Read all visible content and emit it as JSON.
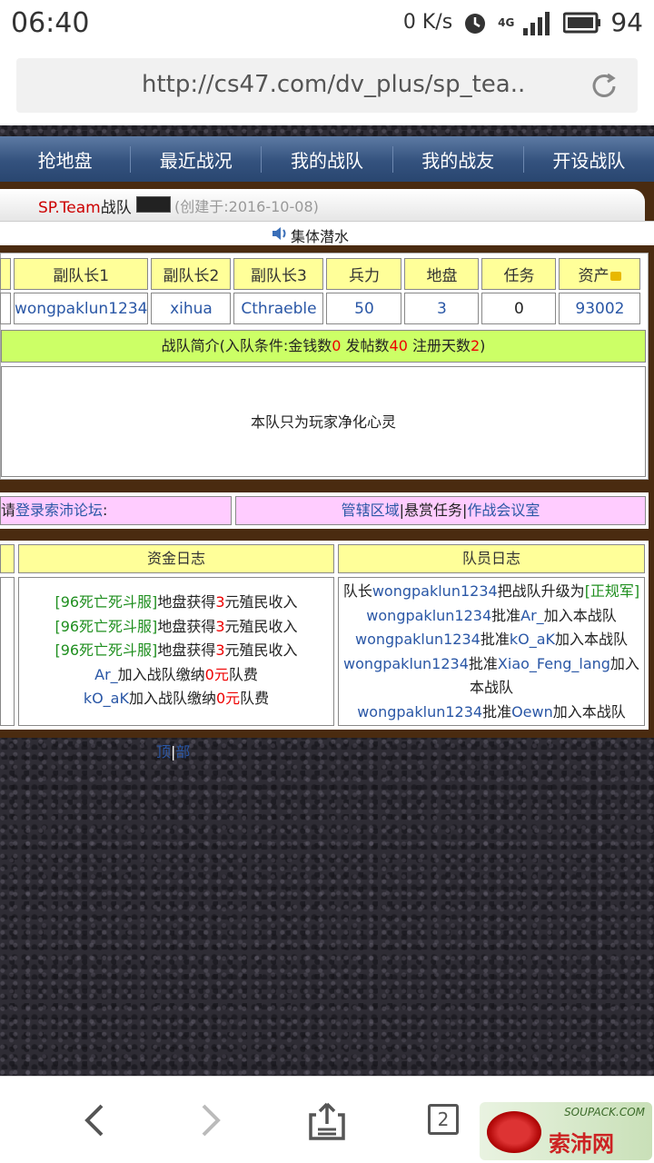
{
  "status": {
    "time": "06:40",
    "net_speed": "0 K/s",
    "network": "4G",
    "battery": "94"
  },
  "browser": {
    "url": "http://cs47.com/dv_plus/sp_tea..",
    "tab_count": "2"
  },
  "nav": [
    "抢地盘",
    "最近战况",
    "我的战队",
    "我的战友",
    "开设战队"
  ],
  "team": {
    "name": "SP.Team",
    "label": "战队",
    "created": "(创建于:2016-10-08)",
    "subtitle": "集体潜水"
  },
  "stats": {
    "headers": [
      "副队长1",
      "副队长2",
      "副队长3",
      "兵力",
      "地盘",
      "任务",
      "资产"
    ],
    "values": [
      "wongpaklun1234",
      "xihua",
      "Cthraeble",
      "50",
      "3",
      "0",
      "93002"
    ]
  },
  "intro": {
    "prefix": "战队简介(入队条件:金钱数",
    "money": "0",
    "posts_label": " 发帖数",
    "posts": "40",
    "days_label": " 注册天数",
    "days": "2",
    "suffix": ")",
    "body": "本队只为玩家净化心灵"
  },
  "links": {
    "left_prefix": "请",
    "left_link": "登录索沛论坛",
    "left_suffix": ":",
    "right": [
      "管辖区域",
      "悬赏任务",
      "作战会议室"
    ]
  },
  "fund_log": {
    "title": "资金日志",
    "entries": [
      {
        "server": "[96死亡死斗服]",
        "text": "地盘获得",
        "amount": "3",
        "unit": "元殖民收入"
      },
      {
        "server": "[96死亡死斗服]",
        "text": "地盘获得",
        "amount": "3",
        "unit": "元殖民收入"
      },
      {
        "server": "[96死亡死斗服]",
        "text": "地盘获得",
        "amount": "3",
        "unit": "元殖民收入"
      },
      {
        "server": "Ar_",
        "text": "加入战队缴纳",
        "amount": "0元",
        "unit": "队费"
      },
      {
        "server": "kO_aK",
        "text": "加入战队缴纳",
        "amount": "0元",
        "unit": "队费"
      }
    ]
  },
  "member_log": {
    "title": "队员日志",
    "line1_prefix": "队长",
    "line1_user": "wongpaklun1234",
    "line1_text": "把战队升级为",
    "line1_rank": "[正规军]",
    "approvals": [
      {
        "by": "wongpaklun1234",
        "verb": "批准",
        "who": "Ar_",
        "rest": "加入本战队"
      },
      {
        "by": "wongpaklun1234",
        "verb": "批准",
        "who": "kO_aK",
        "rest": "加入本战队"
      },
      {
        "by": "wongpaklun1234",
        "verb": "批准",
        "who": "Xiao_Feng_lang",
        "rest": "加入本战队"
      },
      {
        "by": "wongpaklun1234",
        "verb": "批准",
        "who": "Oewn",
        "rest": "加入本战队"
      }
    ]
  },
  "footer": {
    "link1": "顶",
    "sep": "|",
    "link2": "部"
  },
  "watermark": {
    "text": "SOUPACK.COM",
    "cn": "索沛网"
  }
}
